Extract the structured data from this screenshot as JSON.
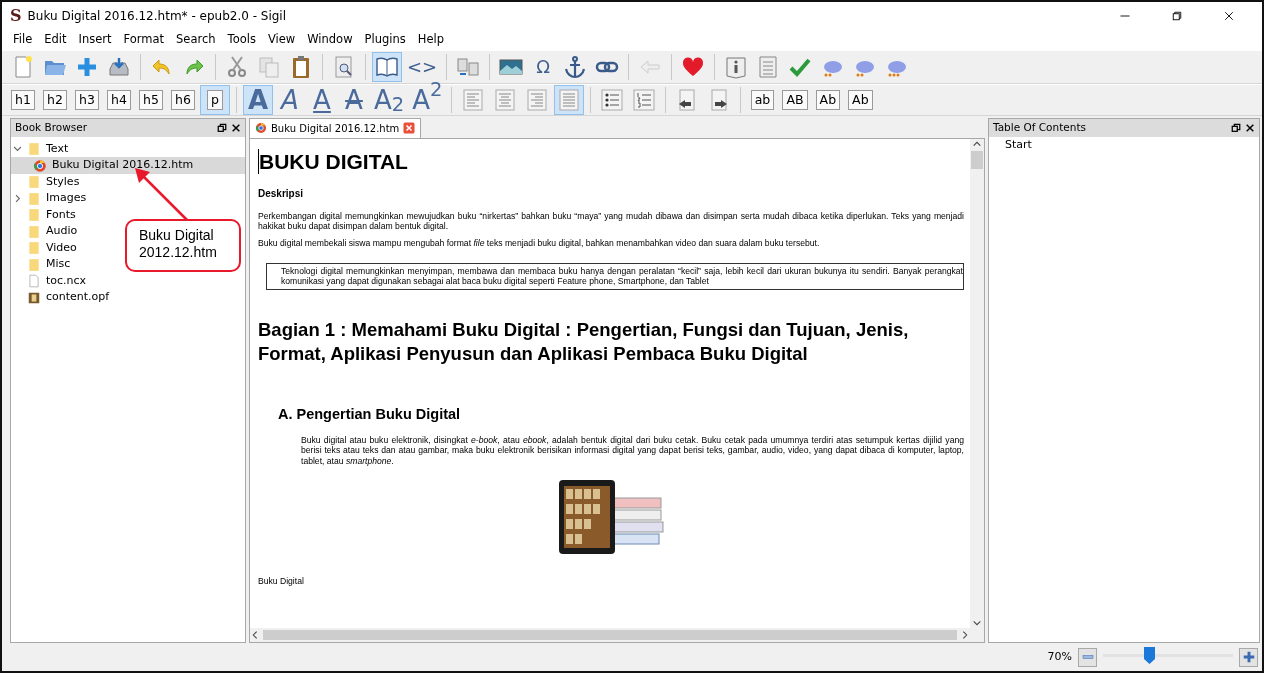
{
  "window": {
    "logo": "S",
    "title": "Buku Digital 2016.12.htm* - epub2.0 - Sigil"
  },
  "menu": [
    "File",
    "Edit",
    "Insert",
    "Format",
    "Search",
    "Tools",
    "View",
    "Window",
    "Plugins",
    "Help"
  ],
  "toolbar_main": [
    {
      "kind": "icon",
      "selected": false
    },
    {
      "kind": "icon",
      "selected": false
    },
    {
      "kind": "icon",
      "selected": false
    },
    {
      "kind": "icon",
      "selected": false
    },
    {
      "kind": "separator"
    },
    {
      "kind": "icon",
      "selected": false
    },
    {
      "kind": "icon",
      "selected": false
    },
    {
      "kind": "separator"
    },
    {
      "kind": "icon",
      "selected": false
    },
    {
      "kind": "icon",
      "selected": false
    },
    {
      "kind": "icon",
      "selected": false
    },
    {
      "kind": "separator"
    },
    {
      "kind": "icon",
      "selected": false
    },
    {
      "kind": "separator"
    },
    {
      "kind": "icon",
      "selected": true
    },
    {
      "kind": "text",
      "label": "<>",
      "selected": false
    },
    {
      "kind": "separator"
    },
    {
      "kind": "icon",
      "selected": false
    },
    {
      "kind": "separator"
    },
    {
      "kind": "icon",
      "selected": false
    },
    {
      "kind": "text",
      "label": "Ω",
      "selected": false
    },
    {
      "kind": "icon",
      "selected": false
    },
    {
      "kind": "icon",
      "selected": false
    },
    {
      "kind": "separator"
    },
    {
      "kind": "icon",
      "selected": false
    },
    {
      "kind": "separator"
    },
    {
      "kind": "icon",
      "selected": false
    },
    {
      "kind": "separator"
    },
    {
      "kind": "icon",
      "selected": false
    },
    {
      "kind": "icon",
      "selected": false
    },
    {
      "kind": "icon",
      "selected": false
    },
    {
      "kind": "icon",
      "selected": false
    },
    {
      "kind": "icon",
      "selected": false
    },
    {
      "kind": "icon",
      "selected": false
    }
  ],
  "toolbar_format": [
    {
      "kind": "boxed",
      "label": "h1",
      "selected": false
    },
    {
      "kind": "boxed",
      "label": "h2",
      "selected": false
    },
    {
      "kind": "boxed",
      "label": "h3",
      "selected": false
    },
    {
      "kind": "boxed",
      "label": "h4",
      "selected": false
    },
    {
      "kind": "boxed",
      "label": "h5",
      "selected": false
    },
    {
      "kind": "boxed",
      "label": "h6",
      "selected": false
    },
    {
      "kind": "boxed",
      "label": "p",
      "selected": true
    },
    {
      "kind": "separator"
    },
    {
      "kind": "glyph",
      "label": "A",
      "selected": true
    },
    {
      "kind": "glyph",
      "label": "A",
      "selected": false
    },
    {
      "kind": "glyph",
      "label": "A",
      "selected": false
    },
    {
      "kind": "glyph",
      "label": "A",
      "selected": false
    },
    {
      "kind": "glyph",
      "label": "A$_{2}$",
      "selected": false
    },
    {
      "kind": "glyph",
      "label": "A$^{2}$",
      "selected": false
    },
    {
      "kind": "separator"
    },
    {
      "kind": "icon",
      "selected": false
    },
    {
      "kind": "icon",
      "selected": false
    },
    {
      "kind": "icon",
      "selected": false
    },
    {
      "kind": "icon",
      "selected": true
    },
    {
      "kind": "separator"
    },
    {
      "kind": "icon",
      "selected": false
    },
    {
      "kind": "icon",
      "selected": false
    },
    {
      "kind": "separator"
    },
    {
      "kind": "icon",
      "selected": false
    },
    {
      "kind": "icon",
      "selected": false
    },
    {
      "kind": "separator"
    },
    {
      "kind": "boxed",
      "label": "ab",
      "selected": false
    },
    {
      "kind": "boxed",
      "label": "AB",
      "selected": false
    },
    {
      "kind": "boxed",
      "label": "Ab",
      "selected": false
    },
    {
      "kind": "boxed",
      "label": "Ab",
      "selected": false
    }
  ],
  "book_browser": {
    "title": "Book Browser",
    "items": [
      {
        "label": "Text",
        "kind": "folder",
        "expanded": true,
        "selected": false,
        "children": [
          {
            "label": "Buku Digital 2016.12.htm",
            "kind": "html",
            "selected": true
          }
        ]
      },
      {
        "label": "Styles",
        "kind": "folder",
        "selected": false
      },
      {
        "label": "Images",
        "kind": "folder",
        "expanded": false,
        "selected": false
      },
      {
        "label": "Fonts",
        "kind": "folder",
        "selected": false
      },
      {
        "label": "Audio",
        "kind": "folder",
        "selected": false
      },
      {
        "label": "Video",
        "kind": "folder",
        "selected": false
      },
      {
        "label": "Misc",
        "kind": "folder",
        "selected": false
      },
      {
        "label": "toc.ncx",
        "kind": "file",
        "selected": false
      },
      {
        "label": "content.opf",
        "kind": "opf",
        "selected": false
      }
    ]
  },
  "annotation": {
    "text": "Buku Digital 2012.12.htm"
  },
  "editor": {
    "tabs": [
      {
        "label": "Buku Digital 2016.12.htm",
        "selected": true
      }
    ],
    "content": [
      {
        "kind": "h1",
        "text": "BUKU DIGITAL"
      },
      {
        "kind": "label",
        "text": "Deskripsi"
      },
      {
        "kind": "p",
        "text": "Perkembangan digital memungkinkan mewujudkan buku “nirkertas” bahkan buku “maya” yang mudah dibawa dan disimpan serta mudah dibaca ketika diperlukan. Teks yang menjadi hakikat buku dapat disimpan dalam bentuk digital."
      },
      {
        "kind": "p",
        "text": "Buku digital membekali siswa mampu mengubah format *file* teks menjadi buku digital, bahkan menambahkan video dan suara dalam buku tersebut."
      },
      {
        "kind": "boxed",
        "text": "Teknologi digital memungkinkan menyimpan, membawa dan membaca buku hanya dengan peralatan “kecil” saja, lebih kecil dari ukuran bukunya itu sendiri. Banyak perangkat komunikasi yang dapat digunakan sebagai alat baca buku digital seperti Feature phone, Smartphone, dan Tablet"
      },
      {
        "kind": "h2",
        "text": "Bagian 1 : Memahami Buku Digital : Pengertian, Fungsi dan Tujuan, Jenis, Format, Aplikasi Penyusun dan Aplikasi Pembaca Buku Digital"
      },
      {
        "kind": "h3",
        "text": "A. Pengertian Buku Digital"
      },
      {
        "kind": "indented",
        "text": "Buku digital atau buku elektronik, disingkat *e-book*, atau *ebook*, adalah bentuk digital dari buku cetak. Buku cetak pada umumnya terdiri atas setumpuk kertas dijilid yang berisi teks atau teks dan atau gambar, maka buku elektronik berisikan informasi digital yang dapat berisi teks, gambar, audio, video, yang dapat dibaca di komputer, laptop, tablet, atau *smartphone*."
      },
      {
        "kind": "image"
      },
      {
        "kind": "p",
        "text": "Buku Digital"
      }
    ]
  },
  "toc": {
    "title": "Table Of Contents",
    "items": [
      {
        "label": "Start"
      }
    ]
  },
  "status_bar": {
    "zoom": "70%",
    "zoom_slider": {
      "level": 0.35
    }
  }
}
